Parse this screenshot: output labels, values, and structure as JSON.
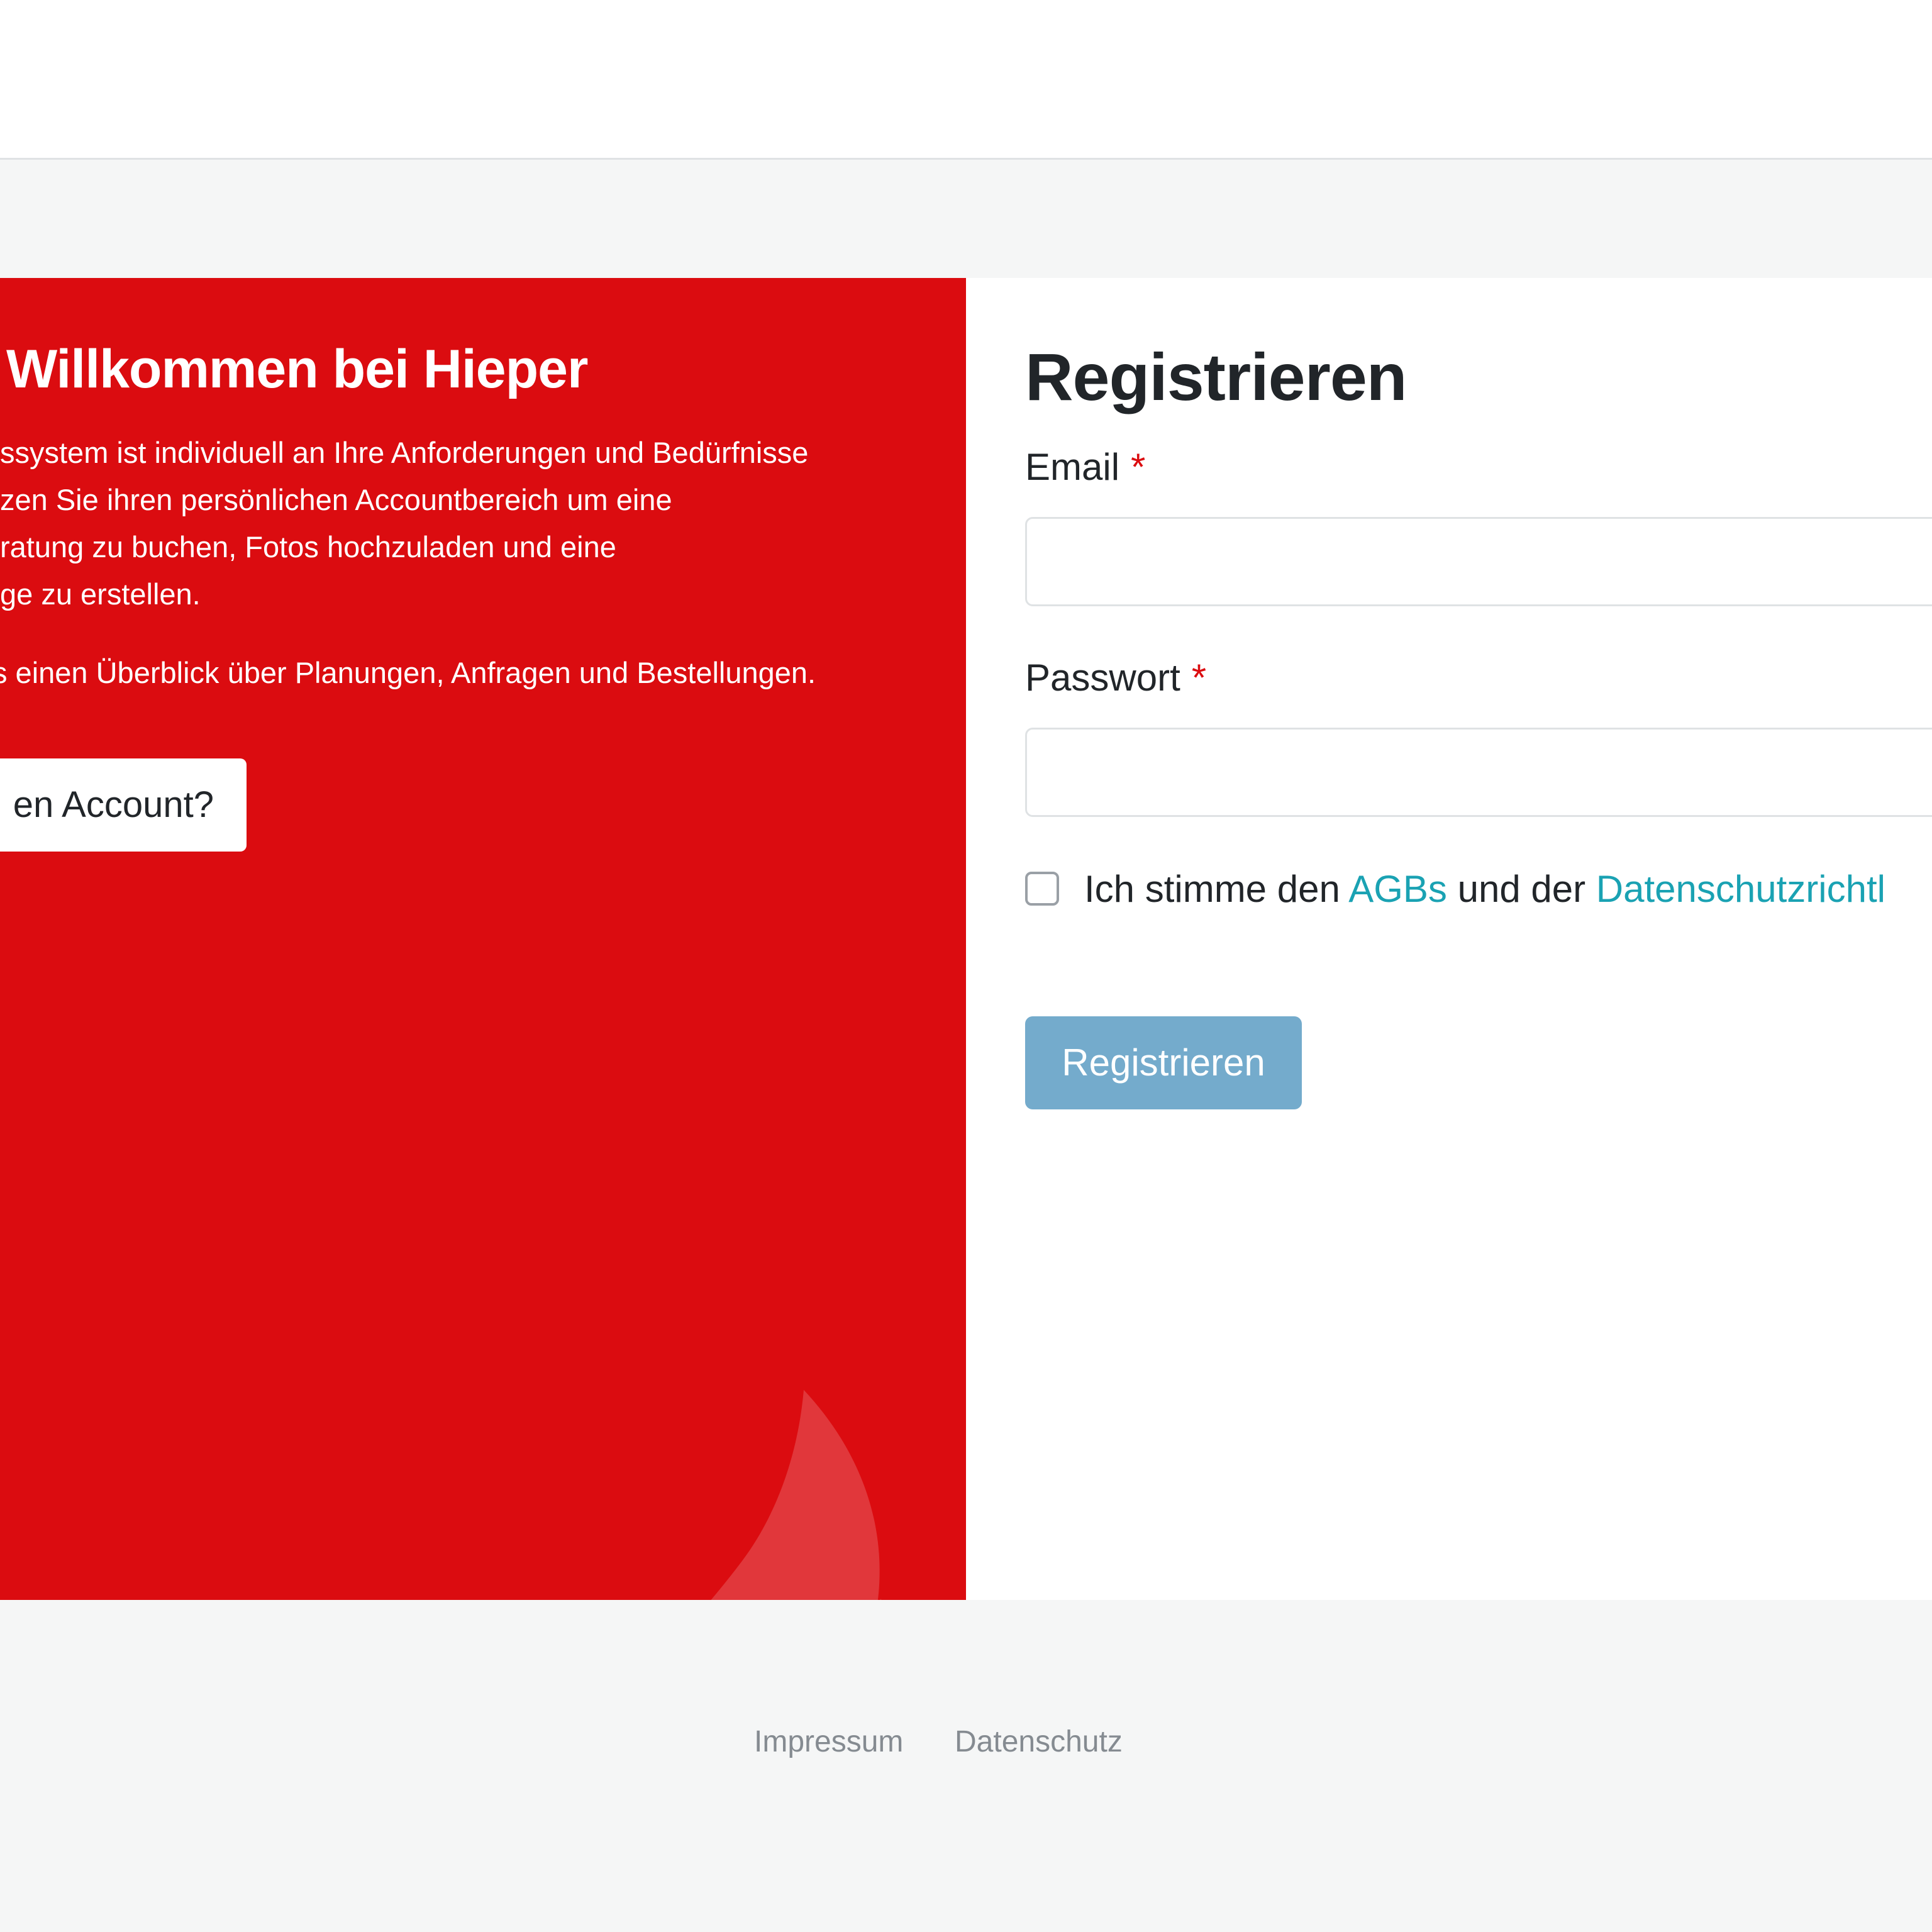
{
  "welcome": {
    "title": "Willkommen bei Hieper",
    "paragraph_lines": [
      "ssystem ist individuell an Ihre Anforderungen und Bedürfnisse",
      "zen Sie ihren persönlichen Accountbereich um eine",
      "ratung zu buchen, Fotos hochzuladen und eine",
      "ge zu erstellen."
    ],
    "overview": "s einen Überblick über Planungen, Anfragen und Bestellungen.",
    "account_button": "en Account?"
  },
  "register": {
    "title": "Registrieren",
    "email_label": "Email",
    "password_label": "Passwort",
    "required_mark": "*",
    "email_value": "",
    "password_value": "",
    "consent_prefix": "Ich stimme den ",
    "agb_link": "AGBs",
    "consent_middle": " und der ",
    "privacy_link": "Datenschutzrichtl",
    "submit_label": "Registrieren"
  },
  "footer": {
    "impressum": "Impressum",
    "datenschutz": "Datenschutz"
  },
  "colors": {
    "brand_red": "#db0c10",
    "link_teal": "#1aa2b3",
    "button_blue": "#74abcc"
  }
}
